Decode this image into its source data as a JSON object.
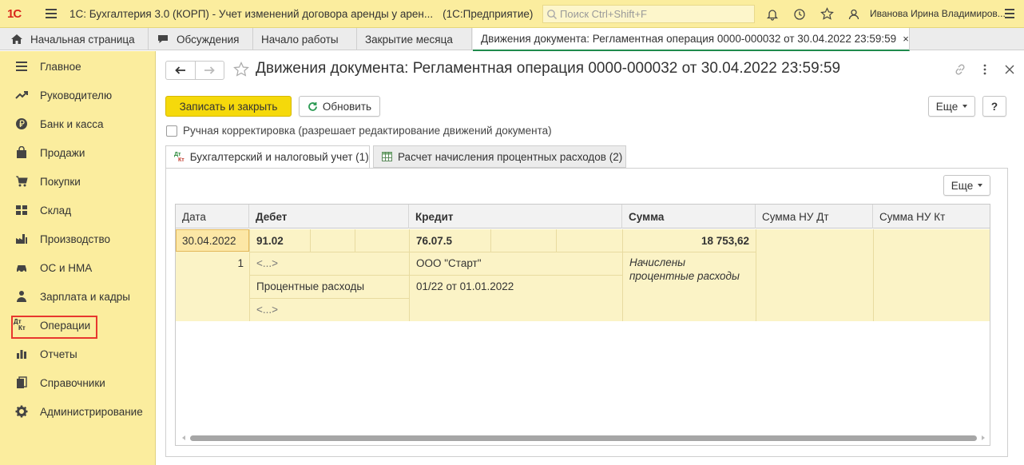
{
  "app": {
    "logo": "1С",
    "title": "1С: Бухгалтерия 3.0 (КОРП) - Учет изменений договора аренды у арен...",
    "platform": "(1С:Предприятие)",
    "search_placeholder": "Поиск Ctrl+Shift+F",
    "user": "Иванова Ирина Владимиров..."
  },
  "tabs": [
    {
      "label": "Начальная страница"
    },
    {
      "label": "Обсуждения"
    },
    {
      "label": "Начало работы"
    },
    {
      "label": "Закрытие месяца"
    },
    {
      "label": "Движения документа: Регламентная операция 0000-000032 от 30.04.2022 23:59:59",
      "close": "×"
    }
  ],
  "sidebar": {
    "items": [
      {
        "label": "Главное",
        "icon": "menu-lines-icon"
      },
      {
        "label": "Руководителю",
        "icon": "trend-icon"
      },
      {
        "label": "Банк и касса",
        "icon": "ruble-coin-icon"
      },
      {
        "label": "Продажи",
        "icon": "shopping-bag-icon"
      },
      {
        "label": "Покупки",
        "icon": "cart-icon"
      },
      {
        "label": "Склад",
        "icon": "warehouse-icon"
      },
      {
        "label": "Производство",
        "icon": "factory-icon"
      },
      {
        "label": "ОС и НМА",
        "icon": "car-icon"
      },
      {
        "label": "Зарплата и кадры",
        "icon": "person-icon"
      },
      {
        "label": "Операции",
        "icon": "dt-kt-icon"
      },
      {
        "label": "Отчеты",
        "icon": "bar-chart-icon"
      },
      {
        "label": "Справочники",
        "icon": "books-icon"
      },
      {
        "label": "Администрирование",
        "icon": "gear-icon"
      }
    ],
    "dt_kt": {
      "dt": "Дт",
      "kt": "Кт"
    }
  },
  "form": {
    "title": "Движения документа: Регламентная операция 0000-000032 от 30.04.2022 23:59:59",
    "save_close": "Записать и закрыть",
    "refresh": "Обновить",
    "more": "Еще",
    "help": "?",
    "manual_checkbox_label": "Ручная корректировка (разрешает редактирование движений документа)",
    "manual_checked": false
  },
  "inner_tabs": [
    {
      "label": "Бухгалтерский и налоговый учет (1)",
      "active": true
    },
    {
      "label": "Расчет начисления процентных расходов (2)",
      "active": false
    }
  ],
  "inner_more": "Еще",
  "grid": {
    "columns": [
      "Дата",
      "Дебет",
      "Кредит",
      "Сумма",
      "Сумма НУ Дт",
      "Сумма НУ Кт"
    ],
    "row": {
      "date": "30.04.2022",
      "line_no": "1",
      "debit_account": "91.02",
      "debit_sub1": "<...>",
      "debit_sub2": "Процентные расходы",
      "debit_sub3": "<...>",
      "credit_account": "76.07.5",
      "credit_sub1": "ООО \"Старт\"",
      "credit_sub2": "01/22 от 01.01.2022",
      "amount": "18 753,62",
      "description_line1": "Начислены",
      "description_line2": "процентные расходы"
    }
  }
}
